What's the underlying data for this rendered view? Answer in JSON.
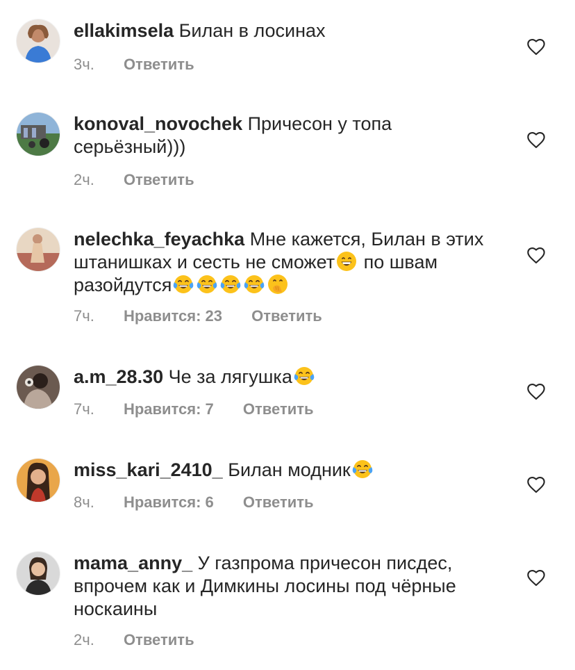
{
  "comments": [
    {
      "username": "ellakimsela",
      "text": "Билан в лосинах",
      "time": "3ч.",
      "likes": "",
      "reply": "Ответить",
      "avatar_color": "#3a7bd5"
    },
    {
      "username": "konoval_novochek",
      "text": "Причесон у топа серьёзный)))",
      "time": "2ч.",
      "likes": "",
      "reply": "Ответить",
      "avatar_color": "#4d7a45"
    },
    {
      "username": "nelechka_feyachka",
      "text_before": "Мне кажется, Билан в этих штанишках и сесть не сможет",
      "text_middle": "  по швам разойдутся",
      "time": "7ч.",
      "likes": "Нравится: 23",
      "reply": "Ответить",
      "avatar_color": "#c89a7a",
      "emojis_1": [
        "grinning-face-emoji"
      ],
      "emojis_2": [
        "tears-of-joy-emoji",
        "tears-of-joy-emoji",
        "tears-of-joy-emoji",
        "tears-of-joy-emoji",
        "hand-over-mouth-emoji"
      ]
    },
    {
      "username": "a.m_28.30",
      "text": "Че за лягушка",
      "time": "7ч.",
      "likes": "Нравится: 7",
      "reply": "Ответить",
      "avatar_color": "#5a4a42",
      "emojis": [
        "tears-of-joy-emoji"
      ]
    },
    {
      "username": "miss_kari_2410_",
      "text": "Билан модник",
      "time": "8ч.",
      "likes": "Нравится: 6",
      "reply": "Ответить",
      "avatar_color": "#d89a3a",
      "emojis": [
        "tears-of-joy-emoji"
      ]
    },
    {
      "username": "mama_anny_",
      "text": "У газпрома причесон писдес, впрочем как и Димкины лосины под чёрные носкаины",
      "time": "2ч.",
      "likes": "",
      "reply": "Ответить",
      "avatar_color": "#2b2b2b"
    }
  ],
  "colors": {
    "text": "#262626",
    "meta": "#8e8e8e",
    "heart": "#262626",
    "emoji_face": "#fcc21b",
    "emoji_tear": "#4ba3f5"
  },
  "icons": {
    "like": "heart-outline-icon"
  }
}
